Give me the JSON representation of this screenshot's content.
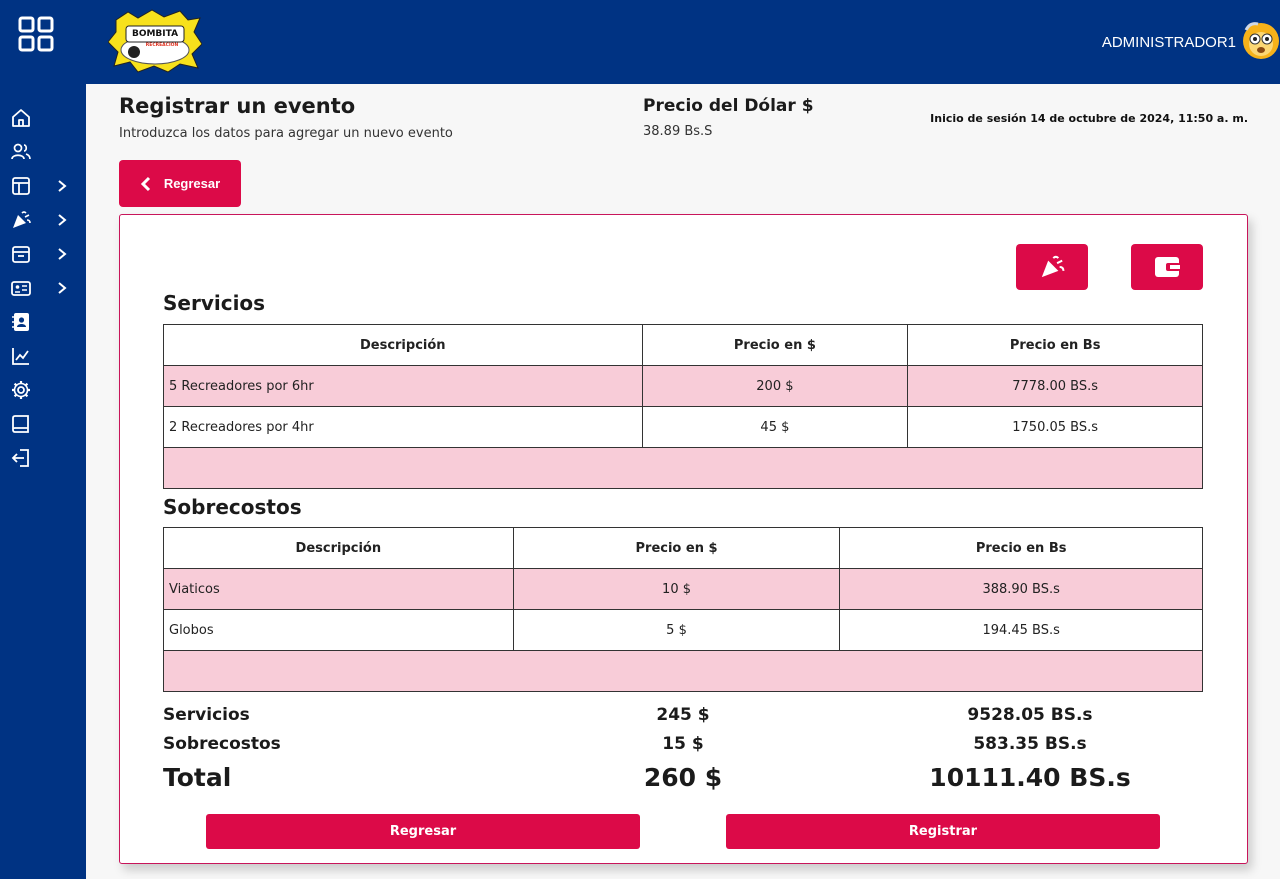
{
  "header": {
    "user_name": "ADMINISTRADOR1",
    "logo_text_top": "BOMBITA",
    "logo_text_bottom": "RECREACION"
  },
  "sidebar": {
    "items": [
      {
        "icon": "home-icon"
      },
      {
        "icon": "users-icon"
      },
      {
        "icon": "layout-icon",
        "has_submenu": true
      },
      {
        "icon": "party-icon",
        "has_submenu": true
      },
      {
        "icon": "archive-icon",
        "has_submenu": true
      },
      {
        "icon": "id-card-icon",
        "has_submenu": true
      },
      {
        "icon": "contact-book-icon"
      },
      {
        "icon": "chart-line-icon"
      },
      {
        "icon": "gear-icon"
      },
      {
        "icon": "book-icon"
      },
      {
        "icon": "logout-icon"
      }
    ]
  },
  "page": {
    "title": "Registrar un evento",
    "subtitle": "Introduzca los datos para agregar un nuevo evento",
    "dollar_label": "Precio del Dólar $",
    "dollar_value": "38.89 Bs.S",
    "session": "Inicio de sesión 14 de octubre de 2024, 11:50 a. m.",
    "back_label": "Regresar"
  },
  "servicios": {
    "title": "Servicios",
    "headers": [
      "Descripción",
      "Precio en $",
      "Precio en Bs"
    ],
    "rows": [
      [
        "5 Recreadores por 6hr",
        "200 $",
        "7778.00 BS.s"
      ],
      [
        "2 Recreadores por 4hr",
        "45 $",
        "1750.05 BS.s"
      ]
    ]
  },
  "sobrecostos": {
    "title": "Sobrecostos",
    "headers": [
      "Descripción",
      "Precio en $",
      "Precio en Bs"
    ],
    "rows": [
      [
        "Viaticos",
        "10 $",
        "388.90 BS.s"
      ],
      [
        "Globos",
        "5 $",
        "194.45 BS.s"
      ]
    ]
  },
  "totals": {
    "servicios": {
      "label": "Servicios",
      "usd": "245 $",
      "bs": "9528.05 BS.s"
    },
    "sobrecostos": {
      "label": "Sobrecostos",
      "usd": "15 $",
      "bs": "583.35 BS.s"
    },
    "total": {
      "label": "Total",
      "usd": "260 $",
      "bs": "10111.40 BS.s"
    }
  },
  "actions": {
    "regresar": "Regresar",
    "registrar": "Registrar"
  },
  "colors": {
    "brand_blue": "#003383",
    "accent": "#dc0a48",
    "row_pink": "#f8ccd8"
  }
}
